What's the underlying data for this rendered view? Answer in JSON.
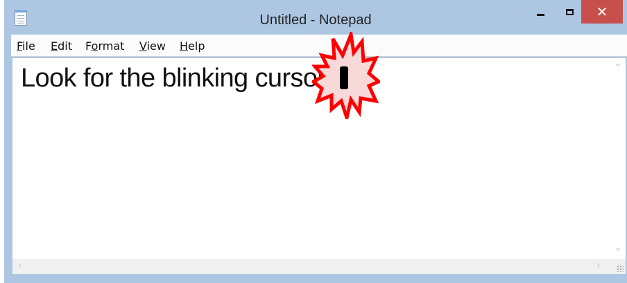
{
  "window": {
    "title": "Untitled - Notepad",
    "controls": {
      "minimize": "",
      "maximize": "",
      "close": "✕"
    }
  },
  "menu": [
    {
      "key": "F",
      "rest": "ile"
    },
    {
      "key": "E",
      "rest": "dit"
    },
    {
      "pre": "F",
      "key": "o",
      "rest": "rmat"
    },
    {
      "key": "V",
      "rest": "iew"
    },
    {
      "key": "H",
      "rest": "elp"
    }
  ],
  "editor": {
    "text": "Look for the blinking cursor"
  },
  "icons": {
    "app": "notepad-icon",
    "highlight": "starburst-highlight-icon",
    "cursor": "text-cursor-icon"
  },
  "colors": {
    "close": "#c7504c",
    "frame": "#adc7e3",
    "burst_fill": "#f7d9d9",
    "burst_stroke": "#ff0000"
  }
}
